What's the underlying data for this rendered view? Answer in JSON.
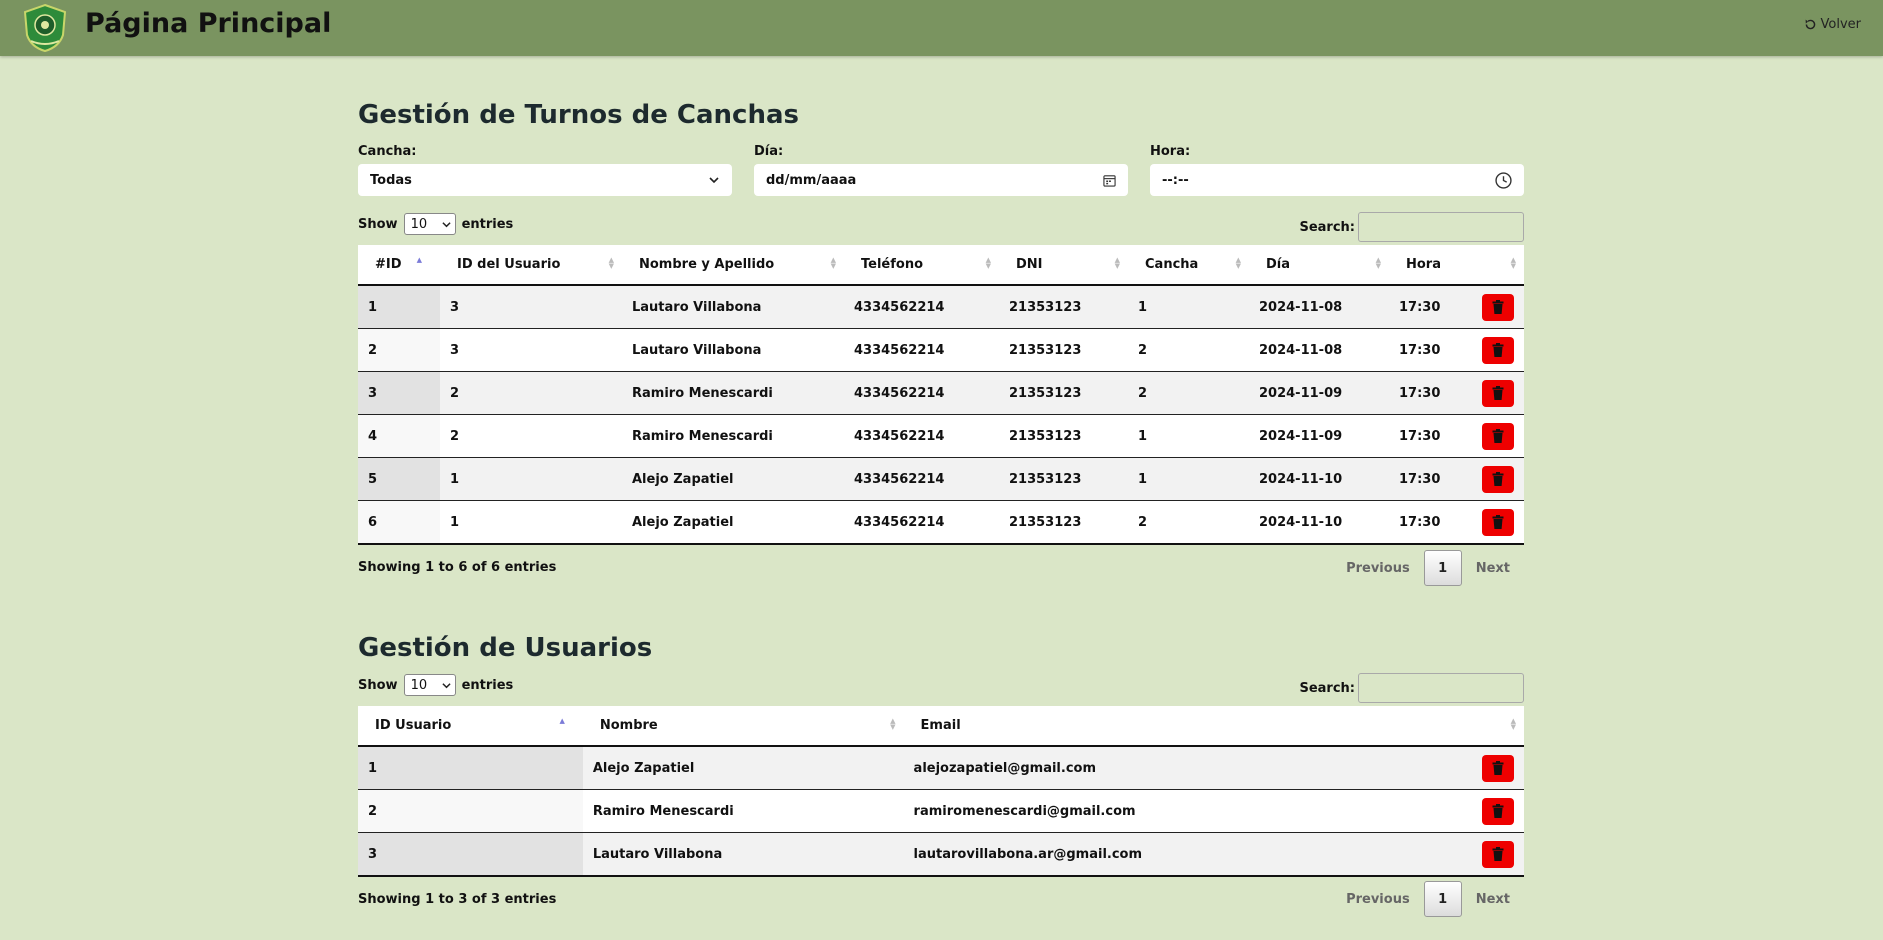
{
  "header": {
    "title": "Página Principal",
    "back_label": "Volver"
  },
  "turnos": {
    "title": "Gestión de Turnos de Canchas",
    "filters": {
      "cancha_label": "Cancha:",
      "cancha_value": "Todas",
      "dia_label": "Día:",
      "dia_placeholder": "dd/mm/aaaa",
      "hora_label": "Hora:",
      "hora_placeholder": "--:--"
    },
    "show_label": "Show",
    "entries_label": "entries",
    "length_value": "10",
    "search_label": "Search:",
    "columns": [
      "#ID",
      "ID del Usuario",
      "Nombre y Apellido",
      "Teléfono",
      "DNI",
      "Cancha",
      "Día",
      "Hora"
    ],
    "rows": [
      [
        "1",
        "3",
        "Lautaro Villabona",
        "4334562214",
        "21353123",
        "1",
        "2024-11-08",
        "17:30"
      ],
      [
        "2",
        "3",
        "Lautaro Villabona",
        "4334562214",
        "21353123",
        "2",
        "2024-11-08",
        "17:30"
      ],
      [
        "3",
        "2",
        "Ramiro Menescardi",
        "4334562214",
        "21353123",
        "2",
        "2024-11-09",
        "17:30"
      ],
      [
        "4",
        "2",
        "Ramiro Menescardi",
        "4334562214",
        "21353123",
        "1",
        "2024-11-09",
        "17:30"
      ],
      [
        "5",
        "1",
        "Alejo Zapatiel",
        "4334562214",
        "21353123",
        "1",
        "2024-11-10",
        "17:30"
      ],
      [
        "6",
        "1",
        "Alejo Zapatiel",
        "4334562214",
        "21353123",
        "2",
        "2024-11-10",
        "17:30"
      ]
    ],
    "info": "Showing 1 to 6 of 6 entries",
    "previous": "Previous",
    "page": "1",
    "next": "Next"
  },
  "usuarios": {
    "title": "Gestión de Usuarios",
    "show_label": "Show",
    "entries_label": "entries",
    "length_value": "10",
    "search_label": "Search:",
    "columns": [
      "ID Usuario",
      "Nombre",
      "Email"
    ],
    "rows": [
      [
        "1",
        "Alejo Zapatiel",
        "alejozapatiel@gmail.com"
      ],
      [
        "2",
        "Ramiro Menescardi",
        "ramiromenescardi@gmail.com"
      ],
      [
        "3",
        "Lautaro Villabona",
        "lautarovillabona.ar@gmail.com"
      ]
    ],
    "info": "Showing 1 to 3 of 3 entries",
    "previous": "Previous",
    "page": "1",
    "next": "Next"
  },
  "icons": {
    "logo": "shield-logo-icon",
    "back": "undo-arrow-icon",
    "delete": "trash-icon",
    "calendar": "calendar-icon",
    "clock": "clock-icon",
    "dropdown": "chevron-down-icon"
  },
  "colors": {
    "background": "#dae6c7",
    "header": "#7a9460",
    "delete": "#ee0000"
  }
}
